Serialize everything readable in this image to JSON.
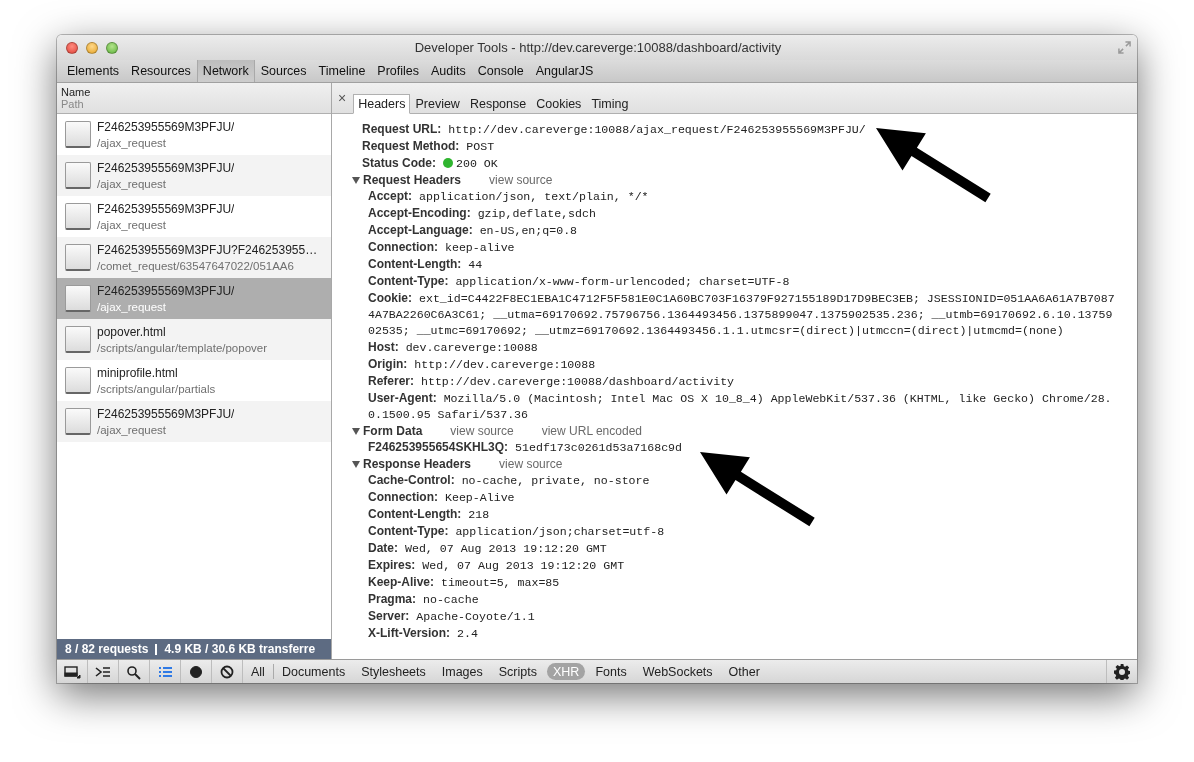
{
  "window": {
    "title": "Developer Tools - http://dev.careverge:10088/dashboard/activity"
  },
  "panel_tabs": [
    {
      "label": "Elements",
      "selected": false
    },
    {
      "label": "Resources",
      "selected": false
    },
    {
      "label": "Network",
      "selected": true
    },
    {
      "label": "Sources",
      "selected": false
    },
    {
      "label": "Timeline",
      "selected": false
    },
    {
      "label": "Profiles",
      "selected": false
    },
    {
      "label": "Audits",
      "selected": false
    },
    {
      "label": "Console",
      "selected": false
    },
    {
      "label": "AngularJS",
      "selected": false
    }
  ],
  "requests_header": {
    "name": "Name",
    "path": "Path"
  },
  "requests": [
    {
      "name": "F246253955569M3PFJU/",
      "path": "/ajax_request",
      "selected": false
    },
    {
      "name": "F246253955569M3PFJU/",
      "path": "/ajax_request",
      "selected": false
    },
    {
      "name": "F246253955569M3PFJU/",
      "path": "/ajax_request",
      "selected": false
    },
    {
      "name": "F246253955569M3PFJU?F246253955…",
      "path": "/comet_request/63547647022/051AA6",
      "selected": false
    },
    {
      "name": "F246253955569M3PFJU/",
      "path": "/ajax_request",
      "selected": true
    },
    {
      "name": "popover.html",
      "path": "/scripts/angular/template/popover",
      "selected": false
    },
    {
      "name": "miniprofile.html",
      "path": "/scripts/angular/partials",
      "selected": false
    },
    {
      "name": "F246253955569M3PFJU/",
      "path": "/ajax_request",
      "selected": false
    }
  ],
  "summary": [
    "8 / 82 requests",
    "4.9 KB / 30.6 KB transferre"
  ],
  "detail": {
    "close": "×",
    "tabs": [
      {
        "label": "Headers",
        "selected": true
      },
      {
        "label": "Preview",
        "selected": false
      },
      {
        "label": "Response",
        "selected": false
      },
      {
        "label": "Cookies",
        "selected": false
      },
      {
        "label": "Timing",
        "selected": false
      }
    ],
    "general": [
      {
        "label": "Request URL:",
        "value": "http://dev.careverge:10088/ajax_request/F246253955569M3PFJU/"
      },
      {
        "label": "Request Method:",
        "value": "POST"
      },
      {
        "label": "Status Code:",
        "value": "200 OK",
        "color": "#2fb52f"
      }
    ],
    "sections": [
      {
        "title": "Request Headers",
        "expanded": true,
        "links": [
          "view source"
        ],
        "headers": [
          {
            "label": "Accept:",
            "value": "application/json, text/plain, */*"
          },
          {
            "label": "Accept-Encoding:",
            "value": "gzip,deflate,sdch"
          },
          {
            "label": "Accept-Language:",
            "value": "en-US,en;q=0.8"
          },
          {
            "label": "Connection:",
            "value": "keep-alive"
          },
          {
            "label": "Content-Length:",
            "value": "44"
          },
          {
            "label": "Content-Type:",
            "value": "application/x-www-form-urlencoded; charset=UTF-8"
          },
          {
            "label": "Cookie:",
            "value": "ext_id=C4422F8EC1EBA1C4712F5F581E0C1A60BC703F16379F927155189D17D9BEC3EB; JSESSIONID=051AA6A61A7B70874A7BA2260C6A3C61; __utma=69170692.75796756.1364493456.1375899047.1375902535.236; __utmb=69170692.6.10.1375902535; __utmc=69170692; __utmz=69170692.1364493456.1.1.utmcsr=(direct)|utmccn=(direct)|utmcmd=(none)"
          },
          {
            "label": "Host:",
            "value": "dev.careverge:10088"
          },
          {
            "label": "Origin:",
            "value": "http://dev.careverge:10088"
          },
          {
            "label": "Referer:",
            "value": "http://dev.careverge:10088/dashboard/activity"
          },
          {
            "label": "User-Agent:",
            "value": "Mozilla/5.0 (Macintosh; Intel Mac OS X 10_8_4) AppleWebKit/537.36 (KHTML, like Gecko) Chrome/28.0.1500.95 Safari/537.36"
          }
        ]
      },
      {
        "title": "Form Data",
        "expanded": true,
        "links": [
          "view source",
          "view URL encoded"
        ],
        "headers": [
          {
            "label": "F246253955654SKHL3Q:",
            "value": "51edf173c0261d53a7168c9d"
          }
        ]
      },
      {
        "title": "Response Headers",
        "expanded": true,
        "links": [
          "view source"
        ],
        "headers": [
          {
            "label": "Cache-Control:",
            "value": "no-cache, private, no-store"
          },
          {
            "label": "Connection:",
            "value": "Keep-Alive"
          },
          {
            "label": "Content-Length:",
            "value": "218"
          },
          {
            "label": "Content-Type:",
            "value": "application/json;charset=utf-8"
          },
          {
            "label": "Date:",
            "value": "Wed, 07 Aug 2013 19:12:20 GMT"
          },
          {
            "label": "Expires:",
            "value": "Wed, 07 Aug 2013 19:12:20 GMT"
          },
          {
            "label": "Keep-Alive:",
            "value": "timeout=5, max=85"
          },
          {
            "label": "Pragma:",
            "value": "no-cache"
          },
          {
            "label": "Server:",
            "value": "Apache-Coyote/1.1"
          },
          {
            "label": "X-Lift-Version:",
            "value": "2.4"
          }
        ]
      }
    ]
  },
  "tools": [
    {
      "kind": "dock",
      "on": false
    },
    {
      "kind": "console",
      "on": false
    },
    {
      "kind": "search",
      "on": false
    },
    {
      "kind": "list",
      "on": true
    },
    {
      "kind": "record",
      "on": false
    },
    {
      "kind": "clear",
      "on": false
    }
  ],
  "filters": [
    {
      "label": "All",
      "selected": false
    },
    {
      "label": "Documents",
      "selected": false
    },
    {
      "label": "Stylesheets",
      "selected": false
    },
    {
      "label": "Images",
      "selected": false
    },
    {
      "label": "Scripts",
      "selected": false
    },
    {
      "label": "XHR",
      "selected": true
    },
    {
      "label": "Fonts",
      "selected": false
    },
    {
      "label": "WebSockets",
      "selected": false
    },
    {
      "label": "Other",
      "selected": false
    }
  ],
  "annotations": [
    {
      "kind": "arrow"
    },
    {
      "kind": "arrow"
    }
  ]
}
